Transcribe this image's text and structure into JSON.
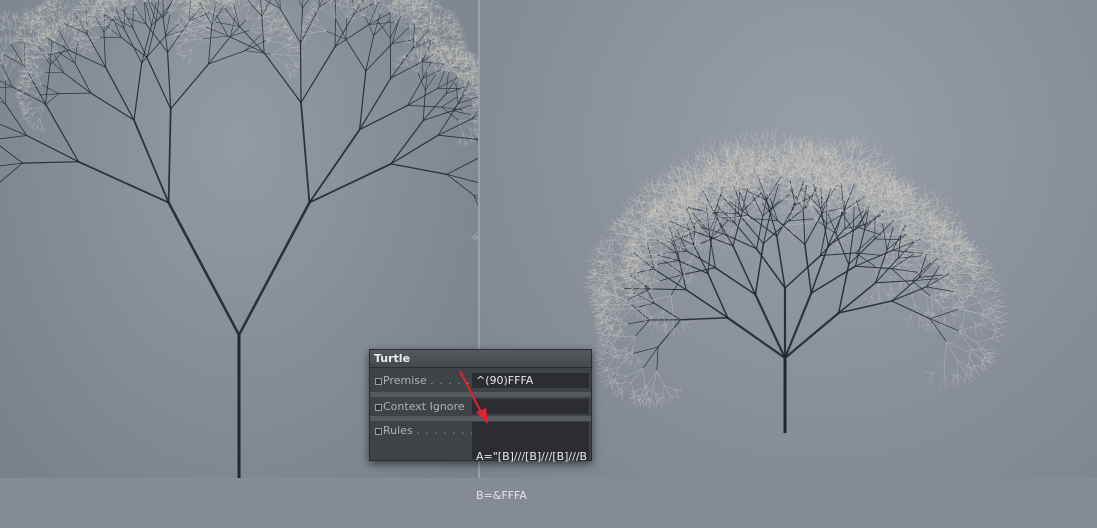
{
  "panel": {
    "title": "Turtle",
    "premise": {
      "label": "Premise",
      "dots": ". . . . . . .",
      "value": "^(90)FFFA"
    },
    "context_ignore": {
      "label": "Context Ignore",
      "value": ""
    },
    "rules": {
      "label": "Rules",
      "dots": ". . . . . . . . .",
      "line1": "A=\"[B]///[B]///[B]///B",
      "line2": "B=&FFFA"
    }
  },
  "colors": {
    "viewport_bg": "#848b95",
    "panel_bg": "#3f4246",
    "annotation_arrow": "#e0232e",
    "branch": "#1f2733"
  },
  "viewports": [
    {
      "name": "left-tree-viewport",
      "depicts": "symmetric two-crown fractal tree"
    },
    {
      "name": "right-tree-viewport",
      "depicts": "dense umbrella fractal tree"
    }
  ]
}
